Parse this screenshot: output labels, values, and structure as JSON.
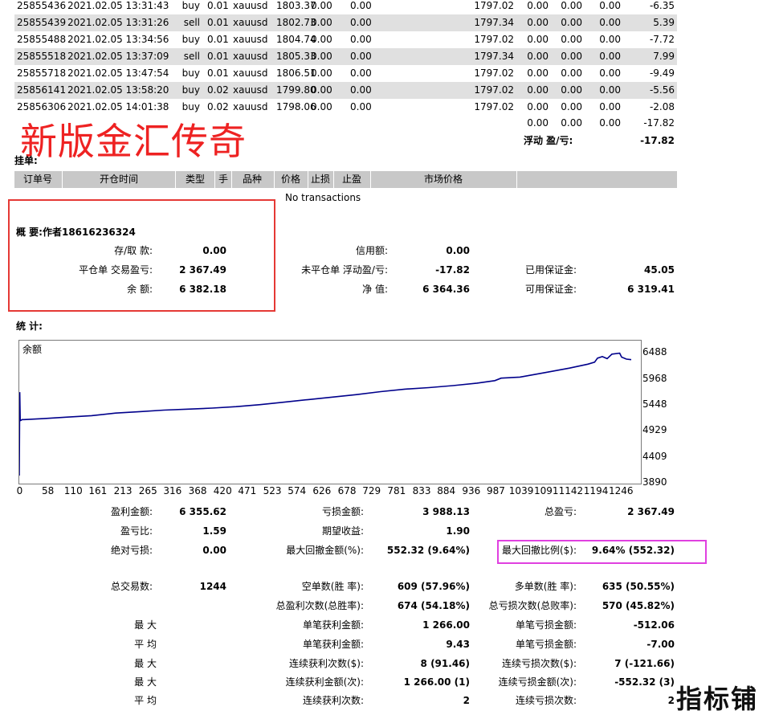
{
  "trades": [
    {
      "ticket": "25855436",
      "time": "2021.02.05 13:31:43",
      "type": "buy",
      "size": "0.01",
      "item": "xauusd",
      "price": "1803.37",
      "sl": "0.00",
      "tp": "0.00",
      "close": "1797.02",
      "comm": "0.00",
      "taxes": "0.00",
      "swap": "0.00",
      "profit": "-6.35"
    },
    {
      "ticket": "25855439",
      "time": "2021.02.05 13:31:26",
      "type": "sell",
      "size": "0.01",
      "item": "xauusd",
      "price": "1802.73",
      "sl": "0.00",
      "tp": "0.00",
      "close": "1797.34",
      "comm": "0.00",
      "taxes": "0.00",
      "swap": "0.00",
      "profit": "5.39"
    },
    {
      "ticket": "25855488",
      "time": "2021.02.05 13:34:56",
      "type": "buy",
      "size": "0.01",
      "item": "xauusd",
      "price": "1804.74",
      "sl": "0.00",
      "tp": "0.00",
      "close": "1797.02",
      "comm": "0.00",
      "taxes": "0.00",
      "swap": "0.00",
      "profit": "-7.72"
    },
    {
      "ticket": "25855518",
      "time": "2021.02.05 13:37:09",
      "type": "sell",
      "size": "0.01",
      "item": "xauusd",
      "price": "1805.33",
      "sl": "0.00",
      "tp": "0.00",
      "close": "1797.34",
      "comm": "0.00",
      "taxes": "0.00",
      "swap": "0.00",
      "profit": "7.99"
    },
    {
      "ticket": "25855718",
      "time": "2021.02.05 13:47:54",
      "type": "buy",
      "size": "0.01",
      "item": "xauusd",
      "price": "1806.51",
      "sl": "0.00",
      "tp": "0.00",
      "close": "1797.02",
      "comm": "0.00",
      "taxes": "0.00",
      "swap": "0.00",
      "profit": "-9.49"
    },
    {
      "ticket": "25856141",
      "time": "2021.02.05 13:58:20",
      "type": "buy",
      "size": "0.02",
      "item": "xauusd",
      "price": "1799.80",
      "sl": "0.00",
      "tp": "0.00",
      "close": "1797.02",
      "comm": "0.00",
      "taxes": "0.00",
      "swap": "0.00",
      "profit": "-5.56"
    },
    {
      "ticket": "25856306",
      "time": "2021.02.05 14:01:38",
      "type": "buy",
      "size": "0.02",
      "item": "xauusd",
      "price": "1798.06",
      "sl": "0.00",
      "tp": "0.00",
      "close": "1797.02",
      "comm": "0.00",
      "taxes": "0.00",
      "swap": "0.00",
      "profit": "-2.08"
    }
  ],
  "totals": {
    "comm": "0.00",
    "taxes": "0.00",
    "swap": "0.00",
    "profit": "-17.82"
  },
  "floating": {
    "label": "浮动 盈/亏:",
    "value": "-17.82"
  },
  "watermark_title": "新版金汇传奇",
  "pending": {
    "title": "挂单:",
    "headers": [
      "订单号",
      "开仓时间",
      "类型",
      "手",
      "品种",
      "价格",
      "止损",
      "止盈",
      "市场价格"
    ],
    "empty": "No transactions"
  },
  "summary": {
    "title": "概 要:作者18616236324",
    "deposit_label": "存/取 款:",
    "deposit": "0.00",
    "credit_label": "信用额:",
    "credit": "0.00",
    "closed_pl_label": "平仓单 交易盈亏:",
    "closed_pl": "2 367.49",
    "floating_label": "未平仓单 浮动盈/亏:",
    "floating_pl": "-17.82",
    "margin_label": "已用保证金:",
    "margin": "45.05",
    "balance_label": "余 额:",
    "balance": "6 382.18",
    "equity_label": "净 值:",
    "equity": "6 364.36",
    "free_margin_label": "可用保证金:",
    "free_margin": "6 319.41"
  },
  "stats_title": "统 计:",
  "chart_data": {
    "type": "line",
    "title": "余额",
    "x_ticks": [
      "0",
      "58",
      "110",
      "161",
      "213",
      "265",
      "316",
      "368",
      "420",
      "471",
      "523",
      "574",
      "626",
      "678",
      "729",
      "781",
      "833",
      "884",
      "936",
      "987",
      "1039",
      "1091",
      "1142",
      "1194",
      "1246"
    ],
    "y_ticks": [
      "6488",
      "5968",
      "5448",
      "4929",
      "4409",
      "3890"
    ],
    "ylim": [
      3890,
      6750
    ],
    "xlim": [
      0,
      1290
    ],
    "line_color": "#00008b",
    "series": [
      {
        "x": [
          0,
          1,
          2,
          4,
          6,
          10,
          50,
          100,
          150,
          200,
          250,
          300,
          350,
          400,
          450,
          500,
          550,
          600,
          650,
          700,
          750,
          800,
          850,
          900,
          950,
          987,
          1000,
          1039,
          1091,
          1142,
          1180,
          1194,
          1200,
          1210,
          1220,
          1230,
          1246,
          1250,
          1260,
          1270
        ],
        "y": [
          4050,
          5720,
          5150,
          5160,
          5170,
          5170,
          5190,
          5220,
          5250,
          5300,
          5330,
          5360,
          5380,
          5400,
          5430,
          5470,
          5520,
          5570,
          5620,
          5670,
          5730,
          5780,
          5810,
          5850,
          5900,
          5950,
          6000,
          6020,
          6110,
          6200,
          6280,
          6320,
          6400,
          6430,
          6390,
          6480,
          6500,
          6420,
          6380,
          6370
        ]
      }
    ]
  },
  "stats": {
    "gross_profit_label": "盈利金额:",
    "gross_profit": "6 355.62",
    "gross_loss_label": "亏损金额:",
    "gross_loss": "3 988.13",
    "net_label": "总盈亏:",
    "net": "2 367.49",
    "pf_label": "盈亏比:",
    "pf": "1.59",
    "ep_label": "期望收益:",
    "ep": "1.90",
    "abs_dd_label": "绝对亏损:",
    "abs_dd": "0.00",
    "max_dd_label": "最大回撤金额(%):",
    "max_dd": "552.32 (9.64%)",
    "rel_dd_label": "最大回撤比例($):",
    "rel_dd": "9.64% (552.32)",
    "total_trades_label": "总交易数:",
    "total_trades": "1244",
    "short_label": "空单数(胜 率):",
    "short": "609 (57.96%)",
    "long_label": "多单数(胜 率):",
    "long": "635 (50.55%)",
    "profit_trades_label": "总盈利次数(总胜率):",
    "profit_trades": "674 (54.18%)",
    "loss_trades_label": "总亏损次数(总败率):",
    "loss_trades": "570 (45.82%)",
    "max1": "最 大",
    "largest_profit_label": "单笔获利金额:",
    "largest_profit": "1 266.00",
    "largest_loss_label": "单笔亏损金额:",
    "largest_loss": "-512.06",
    "avg1": "平 均",
    "avg_profit_label": "单笔获利金额:",
    "avg_profit": "9.43",
    "avg_loss_label": "单笔亏损金额:",
    "avg_loss": "-7.00",
    "max2": "最 大",
    "cons_wins_label": "连续获利次数($):",
    "cons_wins": "8 (91.46)",
    "cons_losses_label": "连续亏损次数($):",
    "cons_losses": "7 (-121.66)",
    "max3": "最 大",
    "cons_profit_label": "连续获利金额(次):",
    "cons_profit": "1 266.00 (1)",
    "cons_loss_label": "连续亏损金额(次):",
    "cons_loss": "-552.32 (3)",
    "avg2": "平 均",
    "avg_cons_wins_label": "连续获利次数:",
    "avg_cons_wins": "2",
    "avg_cons_losses_label": "连续亏损次数:",
    "avg_cons_losses": "2"
  },
  "corner_logo": "指标铺"
}
